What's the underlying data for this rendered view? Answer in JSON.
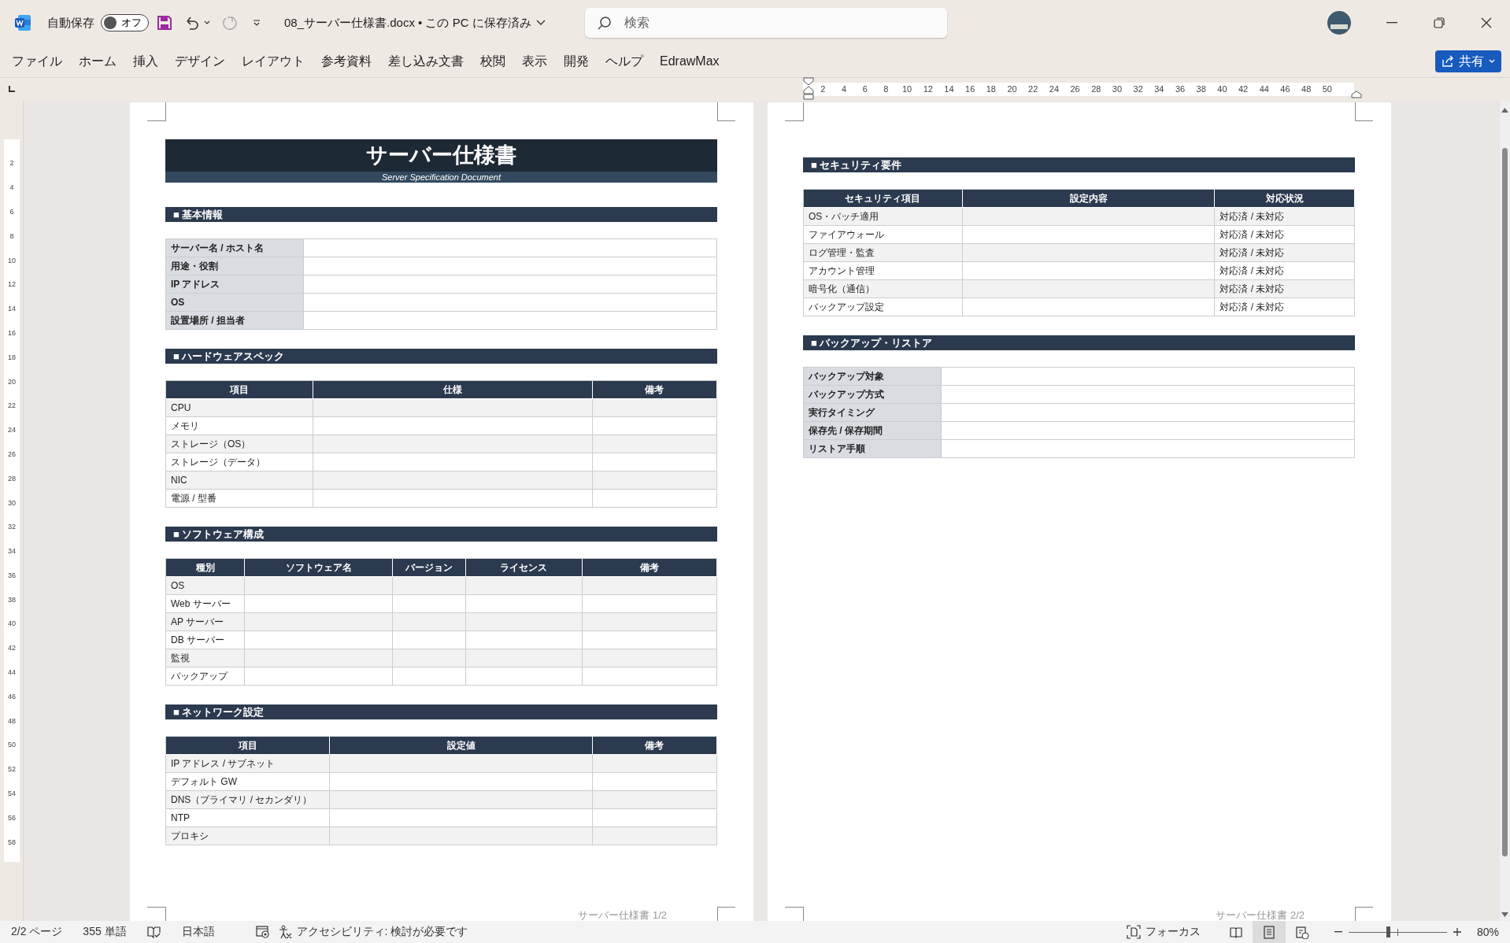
{
  "app_bar": {
    "autosave_label": "自動保存",
    "autosave_toggle": {
      "label": "オフ",
      "on": false
    },
    "file_title": "08_サーバー仕様書.docx • この PC に保存済み",
    "search": {
      "placeholder": "検索"
    }
  },
  "ribbon_tabs": [
    "ファイル",
    "ホーム",
    "挿入",
    "デザイン",
    "レイアウト",
    "参考資料",
    "差し込み文書",
    "校閲",
    "表示",
    "開発",
    "ヘルプ",
    "EdrawMax"
  ],
  "share_button": "共有",
  "ruler": {
    "horizontal": [
      "2",
      "4",
      "6",
      "8",
      "10",
      "12",
      "14",
      "16",
      "18",
      "20",
      "22",
      "24",
      "26",
      "28",
      "30",
      "32",
      "34",
      "36",
      "38",
      "40",
      "42",
      "44",
      "46",
      "48",
      "50"
    ],
    "vertical": [
      "2",
      "4",
      "6",
      "8",
      "10",
      "12",
      "14",
      "16",
      "18",
      "20",
      "22",
      "24",
      "26",
      "28",
      "30",
      "32",
      "34",
      "36",
      "38",
      "40",
      "42",
      "44",
      "46",
      "48",
      "50",
      "52",
      "54",
      "56",
      "58"
    ]
  },
  "pages": [
    {
      "header": {
        "title": "サーバー仕様書",
        "subtitle": "Server Specification Document"
      },
      "sections": [
        {
          "kind": "label_table",
          "title": "■ 基本情報",
          "rows": [
            "サーバー名 / ホスト名",
            "用途・役割",
            "IP アドレス",
            "OS",
            "設置場所 / 担当者"
          ]
        },
        {
          "kind": "grid_table",
          "title": "■ ハードウェアスペック",
          "columns": [
            "項目",
            "仕様",
            "備考"
          ],
          "rows": [
            {
              "label": "CPU"
            },
            {
              "label": "メモリ"
            },
            {
              "label": "ストレージ（OS）"
            },
            {
              "label": "ストレージ（データ）"
            },
            {
              "label": "NIC"
            },
            {
              "label": "電源 / 型番"
            }
          ]
        },
        {
          "kind": "grid_table",
          "title": "■ ソフトウェア構成",
          "columns": [
            "種別",
            "ソフトウェア名",
            "バージョン",
            "ライセンス",
            "備考"
          ],
          "rows": [
            {
              "label": "OS"
            },
            {
              "label": "Web サーバー"
            },
            {
              "label": "AP サーバー"
            },
            {
              "label": "DB サーバー"
            },
            {
              "label": "監視"
            },
            {
              "label": "バックアップ"
            }
          ]
        },
        {
          "kind": "grid_table",
          "title": "■ ネットワーク設定",
          "columns": [
            "項目",
            "設定値",
            "備考"
          ],
          "rows": [
            {
              "label": "IP アドレス / サブネット"
            },
            {
              "label": "デフォルト GW"
            },
            {
              "label": "DNS（プライマリ / セカンダリ）"
            },
            {
              "label": "NTP"
            },
            {
              "label": "プロキシ"
            }
          ]
        }
      ],
      "footer": "サーバー仕様書 1/2"
    },
    {
      "sections": [
        {
          "kind": "grid_table",
          "title": "■ セキュリティ要件",
          "columns": [
            "セキュリティ項目",
            "設定内容",
            "対応状況"
          ],
          "rows": [
            {
              "label": "OS・パッチ適用",
              "status": "対応済 / 未対応"
            },
            {
              "label": "ファイアウォール",
              "status": "対応済 / 未対応"
            },
            {
              "label": "ログ管理・監査",
              "status": "対応済 / 未対応"
            },
            {
              "label": "アカウント管理",
              "status": "対応済 / 未対応"
            },
            {
              "label": "暗号化（通信）",
              "status": "対応済 / 未対応"
            },
            {
              "label": "バックアップ設定",
              "status": "対応済 / 未対応"
            }
          ]
        },
        {
          "kind": "label_table",
          "title": "■ バックアップ・リストア",
          "rows": [
            "バックアップ対象",
            "バックアップ方式",
            "実行タイミング",
            "保存先 / 保存期間",
            "リストア手順"
          ]
        }
      ],
      "footer": "サーバー仕様書 2/2"
    }
  ],
  "status_bar": {
    "page": "2/2 ページ",
    "words": "355 単語",
    "language": "日本語",
    "accessibility": "アクセシビリティ: 検討が必要です",
    "focus": "フォーカス",
    "view_modes": [
      {
        "kind": "read",
        "selected": false
      },
      {
        "kind": "print",
        "selected": true
      },
      {
        "kind": "web",
        "selected": false
      }
    ],
    "zoom": {
      "level": 0.4,
      "reading": "80%"
    }
  }
}
